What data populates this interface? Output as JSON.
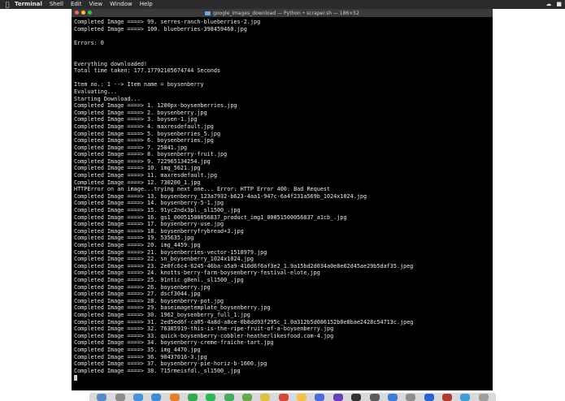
{
  "menubar": {
    "app": "Terminal",
    "items": [
      "Shell",
      "Edit",
      "View",
      "Window",
      "Help"
    ]
  },
  "window": {
    "title": "google_images_download — Python • scraper.sh — 186×52"
  },
  "terminal": {
    "lines": [
      "Completed Image ====> 99. serres-ranch-blueberries-2.jpg",
      "Completed Image ====> 100. blueberries-398459460.jpg",
      "",
      "Errors: 0",
      "",
      "",
      "Everything downloaded!",
      "Total time taken: 177.17792105674744 Seconds",
      "",
      "Item no.: 1 --> Item name = boysenberry",
      "Evaluating...",
      "Starting Download...",
      "Completed Image ====> 1. 1200px-boysenberries.jpg",
      "Completed Image ====> 2. boysenberry.jpg",
      "Completed Image ====> 3. boysen-1.jpg",
      "Completed Image ====> 4. maxresdefault.jpg",
      "Completed Image ====> 5. boysenberries_5.jpg",
      "Completed Image ====> 6. boysenberries.jpg",
      "Completed Image ====> 7. 25841.jpg",
      "Completed Image ====> 8. boysenberry-fruit.jpg",
      "Completed Image ====> 9. 722965134254.jpg",
      "Completed Image ====> 10. img_5621.jpg",
      "Completed Image ====> 11. maxresdefault.jpg",
      "Completed Image ====> 12. 730200_1.jpg",
      "HTTPError on an image...trying next one... Error: HTTP Error 400: Bad Request",
      "Completed Image ====> 13. boysenberry_123a7932-b623-4aa1-947c-6a4f231a569b_1024x1024.jpg",
      "Completed Image ====> 14. boysenberry-5-1.jpg",
      "Completed Image ====> 15. 91yc2ndx3pl._sl1500_.jpg",
      "Completed Image ====> 16. gs1_00051500056837_product_img1_00051500056837_a1cb_.jpg",
      "Completed Image ====> 17. boysenberry-use.jpg",
      "Completed Image ====> 18. boysenberryfrybread+3.jpg",
      "Completed Image ====> 19. 535635.jpg",
      "Completed Image ====> 20. img_4459.jpg",
      "Completed Image ====> 21. boysenberries-vector-1518979.jpg",
      "Completed Image ====> 22. sn_boysenberry_1024x1024.jpg",
      "Completed Image ====> 23. 2e0fc6c4-6245-46ba-a5a9-410d6f6af3e2_1.9a15bd2d034a0e8e62d45ae29b5daf35.jpeg",
      "Completed Image ====> 24. knotts-berry-farm-boysenberry-festival-elote.jpg",
      "Completed Image ====> 25. 91ntic g8enl._sl1500_.jpg",
      "Completed Image ====> 26. boysenberry.jpg",
      "Completed Image ====> 27. dscf3044.jpg",
      "Completed Image ====> 28. boysenberry-pot.jpg",
      "Completed Image ====> 29. baseimagetemplate_boysenberry.jpg",
      "Completed Image ====> 30. 1962_boysenberry_full_1.jpg",
      "Completed Image ====> 31. 2ed5ed6f-ca05-4a8d-a8ce-0b8dd93f295c_1.0a312b5d086152b0e8bae2428c54713c.jpeg",
      "Completed Image ====> 32. 76385919-this-is-the-ripe-fruit-of-a-boysenberry.jpg",
      "Completed Image ====> 33. quick-boysenberry-cobbler-heatherlikesfood.com-4.jpg",
      "Completed Image ====> 34. boysenberry-creme-fraiche-tart.jpg",
      "Completed Image ====> 35. img_4470.jpg",
      "Completed Image ====> 36. 90437016-3.jpg",
      "Completed Image ====> 37. boysenberry-pie-horiz-b-1600.jpg",
      "Completed Image ====> 38. 715rmeisfdl._sl1500_.jpg"
    ]
  },
  "colors": {
    "terminal_bg": "#000000",
    "terminal_fg": "#e9e9e9",
    "menubar_bg": "#2b2b2d"
  }
}
